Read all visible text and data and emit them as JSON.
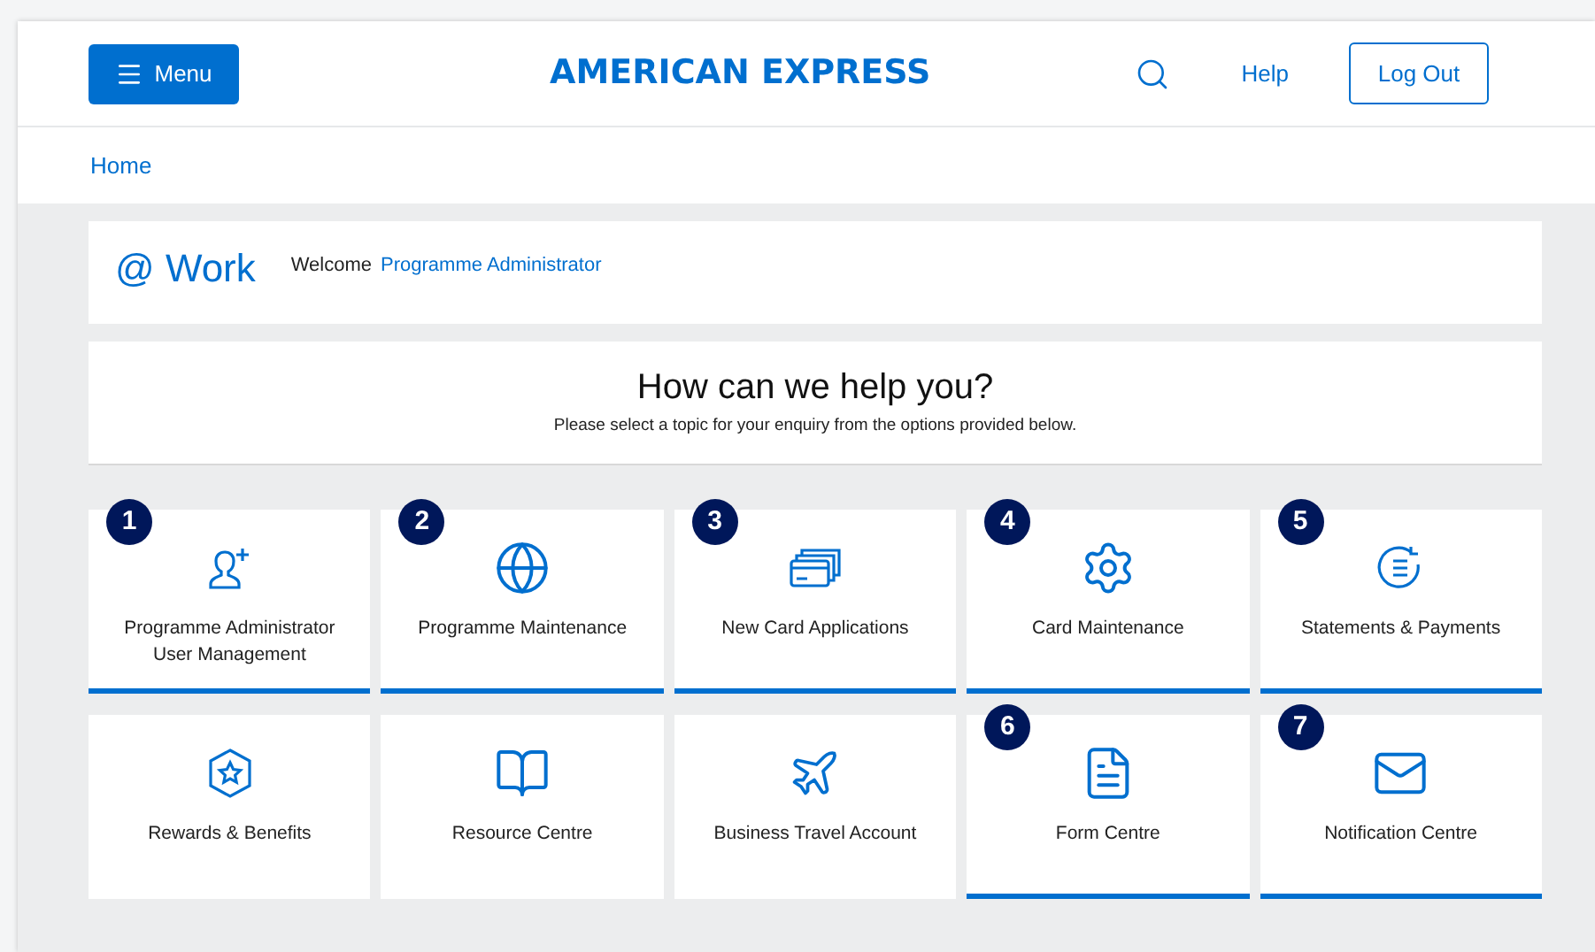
{
  "header": {
    "menu_button": "Menu",
    "logo": "AMERICAN EXPRESS",
    "help_link": "Help",
    "logout_button": "Log Out"
  },
  "breadcrumb": [
    "Home"
  ],
  "welcome": {
    "brand": "@ Work",
    "greeting": "Welcome",
    "user": "Programme Administrator"
  },
  "help": {
    "title": "How can we help you?",
    "subtitle": "Please select a topic for your enquiry from the options provided below."
  },
  "tiles": [
    {
      "label": "Programme Administrator User Management",
      "badge": "1",
      "underlined": true
    },
    {
      "label": "Programme Maintenance",
      "badge": "2",
      "underlined": true
    },
    {
      "label": "New Card Applications",
      "badge": "3",
      "underlined": true
    },
    {
      "label": "Card Maintenance",
      "badge": "4",
      "underlined": true
    },
    {
      "label": "Statements & Payments",
      "badge": "5",
      "underlined": true
    },
    {
      "label": "Rewards & Benefits",
      "underlined": false
    },
    {
      "label": "Resource Centre",
      "underlined": false
    },
    {
      "label": "Business Travel Account",
      "underlined": false
    },
    {
      "label": "Form Centre",
      "badge": "6",
      "underlined": true
    },
    {
      "label": "Notification Centre",
      "badge": "7",
      "underlined": true
    }
  ]
}
